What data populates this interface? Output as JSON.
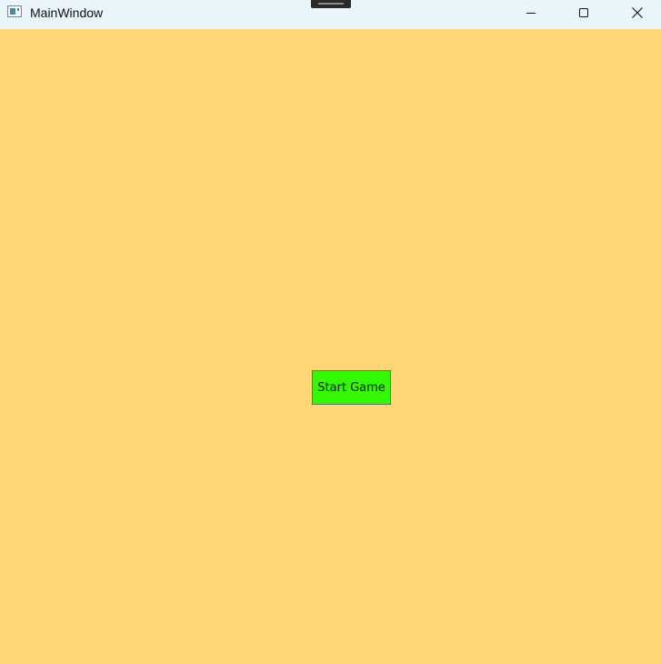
{
  "window": {
    "title": "MainWindow",
    "background_color": "#FED673",
    "titlebar_color": "#E9F5FA"
  },
  "titlebar_controls": {
    "minimize": "minimize-icon",
    "maximize": "maximize-icon",
    "close": "close-icon"
  },
  "main": {
    "start_button_label": "Start Game",
    "start_button_color": "#33F904"
  }
}
